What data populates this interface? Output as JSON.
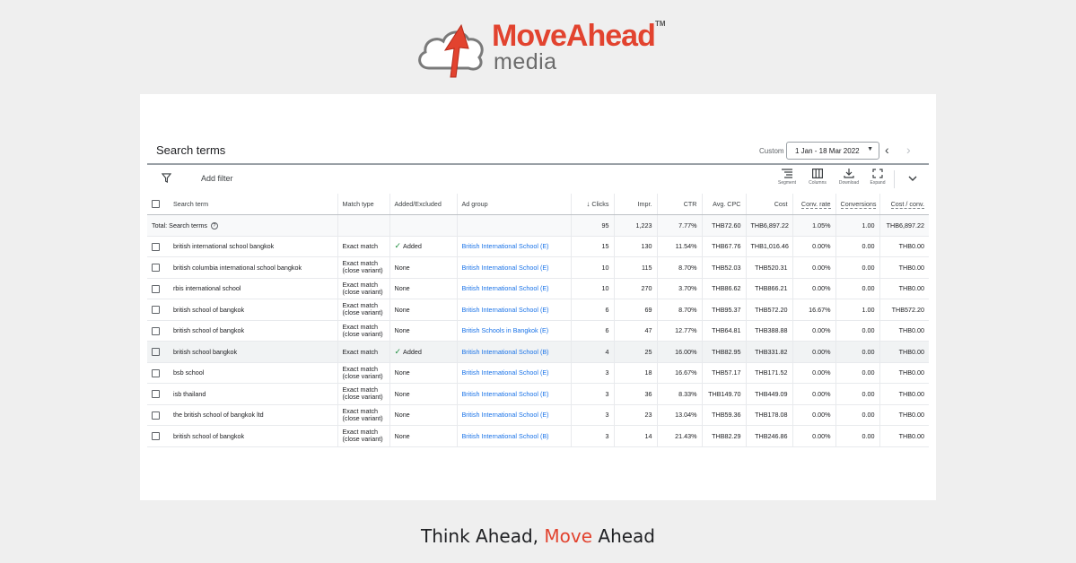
{
  "logo": {
    "word_move": "Move",
    "word_ahead": "Ahead",
    "tm": "TM",
    "sub": "media"
  },
  "header": {
    "title": "Search terms",
    "custom_label": "Custom",
    "date_range": "1 Jan - 18 Mar 2022"
  },
  "toolbar": {
    "add_filter": "Add filter",
    "segment": "Segment",
    "columns": "Columns",
    "download": "Download",
    "expand": "Expand"
  },
  "table": {
    "headers": {
      "search_term": "Search term",
      "match_type": "Match type",
      "added_excluded": "Added/Excluded",
      "ad_group": "Ad group",
      "clicks": "Clicks",
      "impr": "Impr.",
      "ctr": "CTR",
      "avg_cpc": "Avg. CPC",
      "cost": "Cost",
      "conv_rate": "Conv. rate",
      "conversions": "Conversions",
      "cost_conv": "Cost / conv."
    },
    "total": {
      "label": "Total: Search terms",
      "clicks": "95",
      "impr": "1,223",
      "ctr": "7.77%",
      "avg_cpc": "THB72.60",
      "cost": "THB6,897.22",
      "conv_rate": "1.05%",
      "conversions": "1.00",
      "cost_conv": "THB6,897.22"
    },
    "rows": [
      {
        "term": "british international school bangkok",
        "match1": "Exact match",
        "match2": "",
        "added": "Added",
        "ad_group": "British International School (E)",
        "clicks": "15",
        "impr": "130",
        "ctr": "11.54%",
        "avg_cpc": "THB67.76",
        "cost": "THB1,016.46",
        "conv_rate": "0.00%",
        "conversions": "0.00",
        "cost_conv": "THB0.00"
      },
      {
        "term": "british columbia international school bangkok",
        "match1": "Exact match",
        "match2": "(close variant)",
        "added": "None",
        "ad_group": "British International School (E)",
        "clicks": "10",
        "impr": "115",
        "ctr": "8.70%",
        "avg_cpc": "THB52.03",
        "cost": "THB520.31",
        "conv_rate": "0.00%",
        "conversions": "0.00",
        "cost_conv": "THB0.00"
      },
      {
        "term": "rbis international school",
        "match1": "Exact match",
        "match2": "(close variant)",
        "added": "None",
        "ad_group": "British International School (E)",
        "clicks": "10",
        "impr": "270",
        "ctr": "3.70%",
        "avg_cpc": "THB86.62",
        "cost": "THB866.21",
        "conv_rate": "0.00%",
        "conversions": "0.00",
        "cost_conv": "THB0.00"
      },
      {
        "term": "british school of bangkok",
        "match1": "Exact match",
        "match2": "(close variant)",
        "added": "None",
        "ad_group": "British International School (E)",
        "clicks": "6",
        "impr": "69",
        "ctr": "8.70%",
        "avg_cpc": "THB95.37",
        "cost": "THB572.20",
        "conv_rate": "16.67%",
        "conversions": "1.00",
        "cost_conv": "THB572.20"
      },
      {
        "term": "british school of bangkok",
        "match1": "Exact match",
        "match2": "(close variant)",
        "added": "None",
        "ad_group": "British Schools in Bangkok (E)",
        "clicks": "6",
        "impr": "47",
        "ctr": "12.77%",
        "avg_cpc": "THB64.81",
        "cost": "THB388.88",
        "conv_rate": "0.00%",
        "conversions": "0.00",
        "cost_conv": "THB0.00"
      },
      {
        "term": "british school bangkok",
        "match1": "Exact match",
        "match2": "",
        "added": "Added",
        "ad_group": "British International School (B)",
        "clicks": "4",
        "impr": "25",
        "ctr": "16.00%",
        "avg_cpc": "THB82.95",
        "cost": "THB331.82",
        "conv_rate": "0.00%",
        "conversions": "0.00",
        "cost_conv": "THB0.00"
      },
      {
        "term": "bsb school",
        "match1": "Exact match",
        "match2": "(close variant)",
        "added": "None",
        "ad_group": "British International School (E)",
        "clicks": "3",
        "impr": "18",
        "ctr": "16.67%",
        "avg_cpc": "THB57.17",
        "cost": "THB171.52",
        "conv_rate": "0.00%",
        "conversions": "0.00",
        "cost_conv": "THB0.00"
      },
      {
        "term": "isb thailand",
        "match1": "Exact match",
        "match2": "(close variant)",
        "added": "None",
        "ad_group": "British International School (E)",
        "clicks": "3",
        "impr": "36",
        "ctr": "8.33%",
        "avg_cpc": "THB149.70",
        "cost": "THB449.09",
        "conv_rate": "0.00%",
        "conversions": "0.00",
        "cost_conv": "THB0.00"
      },
      {
        "term": "the british school of bangkok ltd",
        "match1": "Exact match",
        "match2": "(close variant)",
        "added": "None",
        "ad_group": "British International School (E)",
        "clicks": "3",
        "impr": "23",
        "ctr": "13.04%",
        "avg_cpc": "THB59.36",
        "cost": "THB178.08",
        "conv_rate": "0.00%",
        "conversions": "0.00",
        "cost_conv": "THB0.00"
      },
      {
        "term": "british school of bangkok",
        "match1": "Exact match",
        "match2": "(close variant)",
        "added": "None",
        "ad_group": "British International School (B)",
        "clicks": "3",
        "impr": "14",
        "ctr": "21.43%",
        "avg_cpc": "THB82.29",
        "cost": "THB246.86",
        "conv_rate": "0.00%",
        "conversions": "0.00",
        "cost_conv": "THB0.00"
      }
    ]
  },
  "tagline": {
    "part1": "Think Ahead, ",
    "part2": "Move",
    "part3": " Ahead"
  },
  "colors": {
    "brand_red": "#e2432f",
    "link_blue": "#1a73e8",
    "check_green": "#1e8e3e"
  },
  "icons": [
    "filter-icon",
    "segment-icon",
    "columns-icon",
    "download-icon",
    "expand-icon",
    "chevron-left-icon",
    "chevron-right-icon",
    "chevron-down-icon",
    "sort-down-icon",
    "help-icon",
    "check-icon"
  ]
}
